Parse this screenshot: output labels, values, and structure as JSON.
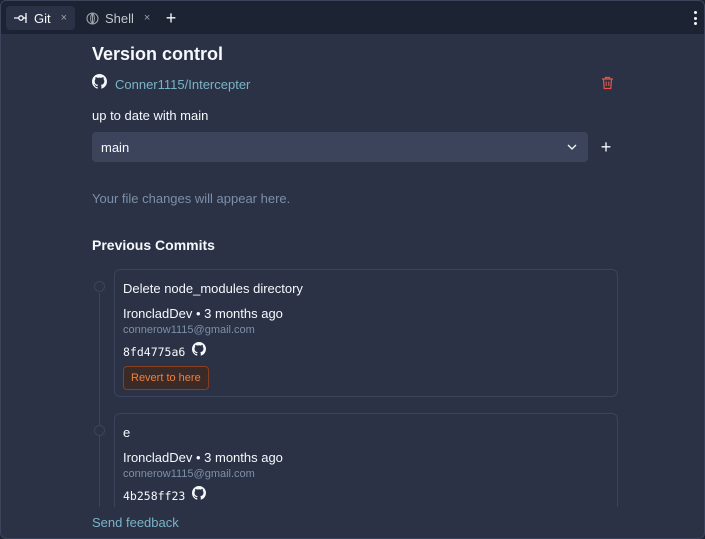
{
  "tabs": [
    {
      "label": "Git",
      "icon": "git-icon",
      "active": true
    },
    {
      "label": "Shell",
      "icon": "shell-icon",
      "active": false
    }
  ],
  "tab_close_glyph": "×",
  "add_tab_glyph": "+",
  "version_control": {
    "title": "Version control",
    "repo": "Conner1115/Intercepter",
    "status": "up to date with main",
    "branch": "main",
    "branch_add_glyph": "+",
    "empty_message": "Your file changes will appear here."
  },
  "commits_section": {
    "title": "Previous Commits",
    "commits": [
      {
        "message": "Delete node_modules directory",
        "author_line": "IroncladDev • 3 months ago",
        "email": "connerow1115@gmail.com",
        "sha": "8fd4775a6",
        "revert_label": "Revert to here"
      },
      {
        "message": "e",
        "author_line": "IroncladDev • 3 months ago",
        "email": "connerow1115@gmail.com",
        "sha": "4b258ff23"
      }
    ]
  },
  "feedback_label": "Send feedback",
  "colors": {
    "background": "#2b3245",
    "surface": "#3c445c",
    "link": "#7ab3c8",
    "danger": "#e5534b",
    "revert": "#f27f3d"
  }
}
